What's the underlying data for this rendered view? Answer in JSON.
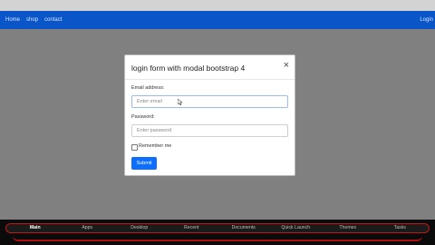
{
  "navbar": {
    "links": [
      "Home",
      "shop",
      "contact"
    ],
    "right": "Login"
  },
  "modal": {
    "title": "login form with modal bootstrap 4",
    "close": "×",
    "email_label": "Email address:",
    "email_placeholder": "Enter email",
    "password_label": "Password:",
    "password_placeholder": "Enter password",
    "remember_label": "Remember me",
    "submit_label": "Submit"
  },
  "taskbar": {
    "items": [
      "Main",
      "Apps",
      "Desktop",
      "Recent",
      "Documents",
      "Quick Launch",
      "Themes",
      "Tasks"
    ],
    "active": "Main"
  },
  "colors": {
    "navbar": "#0a56c8",
    "backdrop": "#808080",
    "primary": "#0d6efd",
    "taskbar_accent": "#c01818"
  }
}
